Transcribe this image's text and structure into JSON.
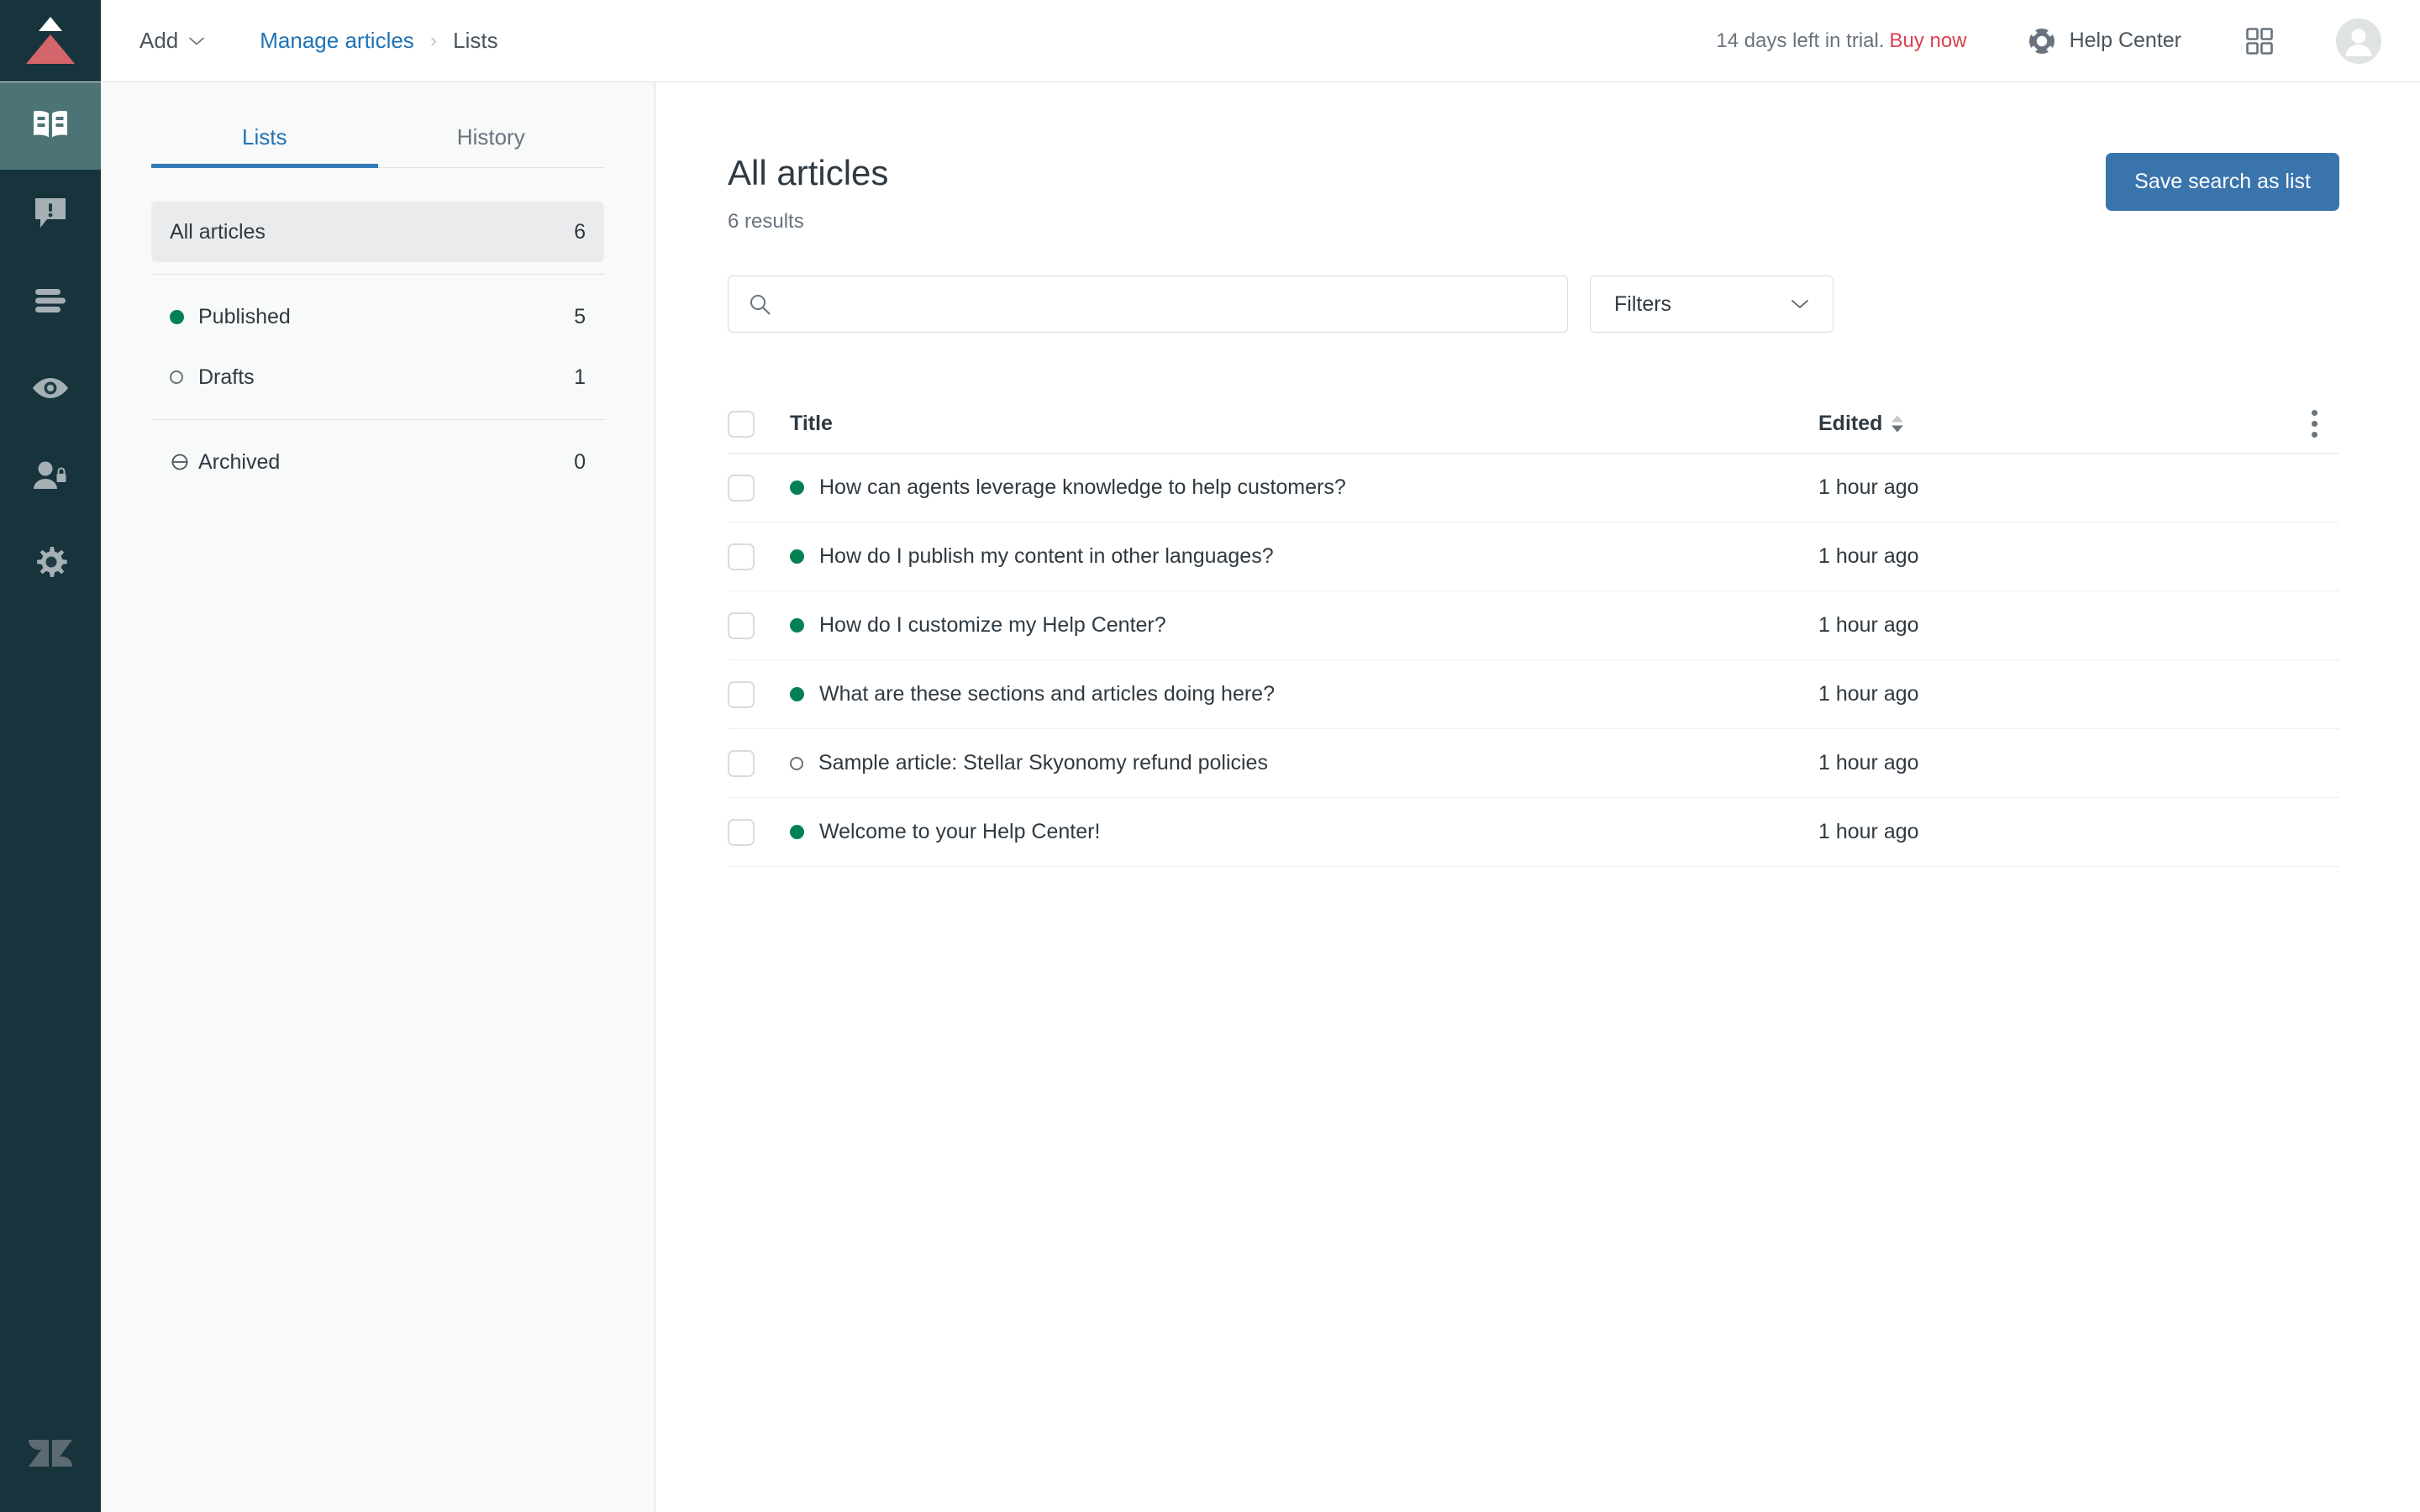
{
  "header": {
    "add_label": "Add",
    "breadcrumb": {
      "parent": "Manage articles",
      "separator": "›",
      "current": "Lists"
    },
    "trial_text": "14 days left in trial.",
    "trial_cta": "Buy now",
    "help_center_label": "Help Center",
    "icons": {
      "chevron_down": "chevron-down-icon",
      "lifebuoy": "lifebuoy-icon",
      "apps_grid": "apps-grid-icon",
      "avatar": "user-avatar-icon"
    },
    "colors": {
      "link_blue": "#1f73b7",
      "buy_now_red": "#d93f4c",
      "rail_dark": "#17333b",
      "rail_active": "#4c7375"
    }
  },
  "rail": {
    "items": [
      {
        "name": "guide-knowledge",
        "icon": "open-book-icon",
        "active": true
      },
      {
        "name": "announcements",
        "icon": "alert-speech-bubble-icon",
        "active": false
      },
      {
        "name": "arrange-content",
        "icon": "list-lines-icon",
        "active": false
      },
      {
        "name": "preview",
        "icon": "eye-icon",
        "active": false
      },
      {
        "name": "user-permissions",
        "icon": "user-lock-icon",
        "active": false
      },
      {
        "name": "settings",
        "icon": "gear-icon",
        "active": false
      }
    ],
    "brand_logo": "zendesk-logo-icon"
  },
  "lists_panel": {
    "tabs": [
      {
        "label": "Lists",
        "active": true
      },
      {
        "label": "History",
        "active": false
      }
    ],
    "primary": [
      {
        "label": "All articles",
        "count": "6",
        "icon": "none",
        "selected": true
      }
    ],
    "status_group": [
      {
        "label": "Published",
        "count": "5",
        "icon": "filled-dot-icon",
        "selected": false
      },
      {
        "label": "Drafts",
        "count": "1",
        "icon": "hollow-dot-icon",
        "selected": false
      }
    ],
    "archive_group": [
      {
        "label": "Archived",
        "count": "0",
        "icon": "archive-circle-icon",
        "selected": false
      }
    ]
  },
  "main": {
    "title": "All articles",
    "results": "6 results",
    "save_button": "Save search as list",
    "search": {
      "value": "",
      "placeholder": "",
      "icon": "search-icon"
    },
    "filters_label": "Filters",
    "table": {
      "columns": {
        "title": "Title",
        "edited": "Edited"
      },
      "sort": {
        "column": "Edited",
        "direction": "descending"
      },
      "rows": [
        {
          "status": "published",
          "title": "How can agents leverage knowledge to help customers?",
          "edited": "1 hour ago"
        },
        {
          "status": "published",
          "title": "How do I publish my content in other languages?",
          "edited": "1 hour ago"
        },
        {
          "status": "published",
          "title": "How do I customize my Help Center?",
          "edited": "1 hour ago"
        },
        {
          "status": "published",
          "title": "What are these sections and articles doing here?",
          "edited": "1 hour ago"
        },
        {
          "status": "draft",
          "title": "Sample article: Stellar Skyonomy refund policies",
          "edited": "1 hour ago"
        },
        {
          "status": "published",
          "title": "Welcome to your Help Center!",
          "edited": "1 hour ago"
        }
      ]
    },
    "colors": {
      "primary_button": "#3a74ad",
      "published_dot": "#038153",
      "draft_dot": "#68737d"
    }
  }
}
